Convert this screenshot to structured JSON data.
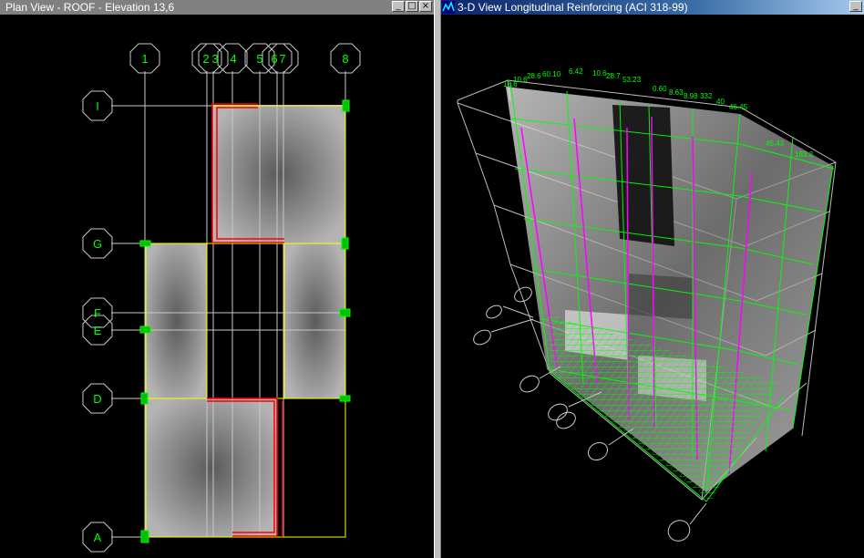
{
  "plan_view": {
    "title": "Plan View - ROOF - Elevation 13,6",
    "grid_x": [
      "1",
      "2",
      "3",
      "4",
      "5",
      "6",
      "7",
      "8"
    ],
    "grid_y": [
      "I",
      "G",
      "F",
      "E",
      "D",
      "A"
    ]
  },
  "view_3d": {
    "title": "3-D View  Longitudinal Reinforcing  (ACI 318-99)",
    "annotations": [
      "18.6",
      "10.6",
      "28.6",
      "60.10",
      "6.42",
      "10.6",
      "28.7",
      "53.23",
      "0.60",
      "8.63",
      "8.98",
      "332",
      "40",
      "46.45",
      "45.43",
      "183.2"
    ]
  },
  "window_buttons": {
    "minimize": "_",
    "maximize": "□",
    "close": "×"
  },
  "colors": {
    "grid_bubble": "#00c000",
    "label": "#00ff00",
    "slab_edge": "#ffff00",
    "wall": "#ff0000",
    "reinforcing": "#00ff00",
    "column": "#ff00ff"
  }
}
